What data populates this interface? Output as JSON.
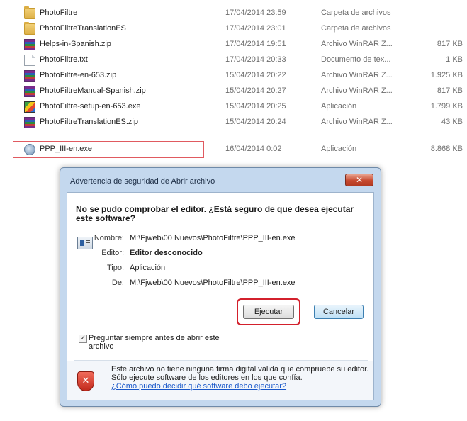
{
  "files": [
    {
      "name": "PhotoFiltre",
      "date": "17/04/2014 23:59",
      "type": "Carpeta de archivos",
      "size": "",
      "icon": "folder-icon"
    },
    {
      "name": "PhotoFiltreTranslationES",
      "date": "17/04/2014 23:01",
      "type": "Carpeta de archivos",
      "size": "",
      "icon": "folder-icon"
    },
    {
      "name": "Helps-in-Spanish.zip",
      "date": "17/04/2014 19:51",
      "type": "Archivo WinRAR Z...",
      "size": "817 KB",
      "icon": "winrar-zip-icon"
    },
    {
      "name": "PhotoFiltre.txt",
      "date": "17/04/2014 20:33",
      "type": "Documento de tex...",
      "size": "1 KB",
      "icon": "text-document-icon"
    },
    {
      "name": "PhotoFiltre-en-653.zip",
      "date": "15/04/2014 20:22",
      "type": "Archivo WinRAR Z...",
      "size": "1.925 KB",
      "icon": "winrar-zip-icon"
    },
    {
      "name": "PhotoFiltreManual-Spanish.zip",
      "date": "15/04/2014 20:27",
      "type": "Archivo WinRAR Z...",
      "size": "817 KB",
      "icon": "winrar-zip-icon"
    },
    {
      "name": "PhotoFiltre-setup-en-653.exe",
      "date": "15/04/2014 20:25",
      "type": "Aplicación",
      "size": "1.799 KB",
      "icon": "photofiltre-exe-icon"
    },
    {
      "name": "PhotoFiltreTranslationES.zip",
      "date": "15/04/2014 20:24",
      "type": "Archivo WinRAR Z...",
      "size": "43 KB",
      "icon": "winrar-zip-icon"
    },
    {
      "name": "PPP_III-en.exe",
      "date": "16/04/2014 0:02",
      "type": "Aplicación",
      "size": "8.868 KB",
      "icon": "setup-exe-icon"
    }
  ],
  "dialog": {
    "title": "Advertencia de seguridad de Abrir archivo",
    "close_glyph": "✕",
    "question": "No se pudo comprobar el editor. ¿Está seguro de que desea ejecutar este software?",
    "name_label": "Nombre:",
    "name_value": "M:\\Fjweb\\00 Nuevos\\PhotoFiltre\\PPP_III-en.exe",
    "publisher_label": "Editor:",
    "publisher_value": "Editor desconocido",
    "type_label": "Tipo:",
    "type_value": "Aplicación",
    "from_label": "De:",
    "from_value": "M:\\Fjweb\\00 Nuevos\\PhotoFiltre\\PPP_III-en.exe",
    "run_button": "Ejecutar",
    "cancel_button": "Cancelar",
    "checkbox_checked": true,
    "checkbox_glyph": "✓",
    "checkbox_label": "Preguntar siempre antes de abrir este archivo",
    "warning_text": "Este archivo no tiene ninguna firma digital válida que compruebe su editor. Sólo ejecute software de los editores en los que confía.",
    "warning_link": "¿Cómo puedo decidir qué software debo ejecutar?",
    "shield_glyph": "✕"
  },
  "colors": {
    "highlight_red": "#d3202c",
    "dialog_frame": "#c4d8ee",
    "link_blue": "#1a58c9"
  }
}
